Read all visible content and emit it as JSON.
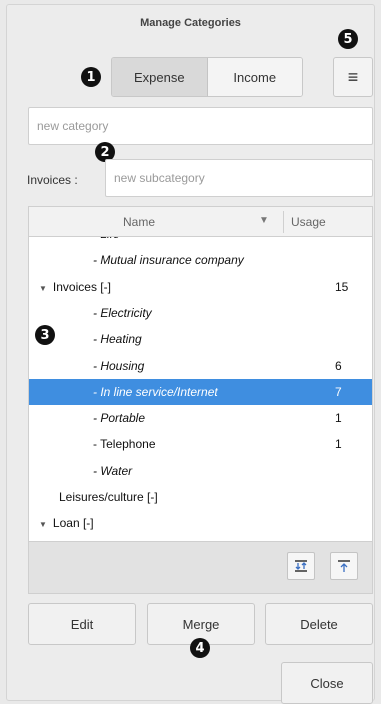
{
  "window": {
    "title": "Manage Categories"
  },
  "toggle": {
    "expense_label": "Expense",
    "income_label": "Income",
    "selected": "Expense"
  },
  "menu_icon": "≡",
  "new_category": {
    "placeholder": "new category"
  },
  "subcategory": {
    "parent_label": "Invoices :",
    "placeholder": "new subcategory"
  },
  "table": {
    "columns": {
      "name": "Name",
      "usage": "Usage"
    },
    "rows": [
      {
        "label": "- Life",
        "usage": "",
        "italic": true,
        "indent": 2,
        "expander": false,
        "selected": false
      },
      {
        "label": "- Mutual insurance company",
        "usage": "",
        "italic": true,
        "indent": 2,
        "expander": false,
        "selected": false
      },
      {
        "label": "Invoices [-]",
        "usage": "15",
        "italic": false,
        "indent": 0,
        "expander": true,
        "selected": false
      },
      {
        "label": "- Electricity",
        "usage": "",
        "italic": true,
        "indent": 2,
        "expander": false,
        "selected": false
      },
      {
        "label": "- Heating",
        "usage": "",
        "italic": true,
        "indent": 2,
        "expander": false,
        "selected": false
      },
      {
        "label": "- Housing",
        "usage": "6",
        "italic": true,
        "indent": 2,
        "expander": false,
        "selected": false
      },
      {
        "label": "- In line service/Internet",
        "usage": "7",
        "italic": true,
        "indent": 2,
        "expander": false,
        "selected": true
      },
      {
        "label": "- Portable",
        "usage": "1",
        "italic": true,
        "indent": 2,
        "expander": false,
        "selected": false
      },
      {
        "label": "- Telephone",
        "usage": "1",
        "italic": false,
        "indent": 2,
        "expander": false,
        "selected": false
      },
      {
        "label": "- Water",
        "usage": "",
        "italic": true,
        "indent": 2,
        "expander": false,
        "selected": false
      },
      {
        "label": "Leisures/culture [-]",
        "usage": "",
        "italic": false,
        "indent": 1,
        "expander": false,
        "selected": false
      },
      {
        "label": "Loan [-]",
        "usage": "",
        "italic": false,
        "indent": 0,
        "expander": true,
        "selected": false
      }
    ]
  },
  "tree_tools": {
    "expand_icon": "expand-all-icon",
    "collapse_icon": "collapse-all-icon"
  },
  "buttons": {
    "edit": "Edit",
    "merge": "Merge",
    "delete": "Delete",
    "close": "Close"
  },
  "callouts": [
    "1",
    "2",
    "3",
    "4",
    "5"
  ],
  "colors": {
    "selection": "#3f8ee0",
    "callout": "#111111"
  }
}
